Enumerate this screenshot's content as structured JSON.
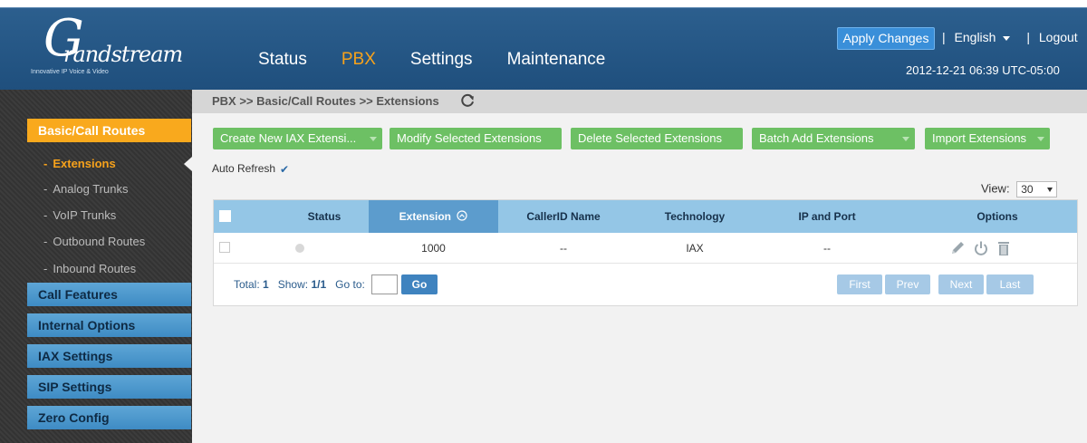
{
  "header": {
    "logo_text": "Grandstream",
    "logo_tagline": "Innovative IP Voice & Video",
    "nav": [
      {
        "label": "Status",
        "active": false
      },
      {
        "label": "PBX",
        "active": true
      },
      {
        "label": "Settings",
        "active": false
      },
      {
        "label": "Maintenance",
        "active": false
      }
    ],
    "apply_changes": "Apply Changes",
    "separator": "|",
    "language": "English",
    "logout": "Logout",
    "datetime": "2012-12-21 06:39 UTC-05:00"
  },
  "sidebar": {
    "active_section": "Basic/Call Routes",
    "sub_items": [
      {
        "label": "Extensions",
        "active": true
      },
      {
        "label": "Analog Trunks",
        "active": false
      },
      {
        "label": "VoIP Trunks",
        "active": false
      },
      {
        "label": "Outbound Routes",
        "active": false
      },
      {
        "label": "Inbound Routes",
        "active": false
      }
    ],
    "sections": [
      "Call Features",
      "Internal Options",
      "IAX Settings",
      "SIP Settings",
      "Zero Config"
    ]
  },
  "breadcrumb": "PBX >> Basic/Call Routes >> Extensions",
  "toolbar": {
    "create": "Create New IAX Extensi...",
    "modify": "Modify Selected Extensions",
    "delete": "Delete Selected Extensions",
    "batch_add": "Batch Add Extensions",
    "import": "Import Extensions"
  },
  "auto_refresh": {
    "label": "Auto Refresh",
    "checked": true
  },
  "view": {
    "label": "View:",
    "value": "30"
  },
  "table": {
    "columns": [
      "Status",
      "Extension",
      "CallerID Name",
      "Technology",
      "IP and Port",
      "Options"
    ],
    "sorted_column": "Extension",
    "rows": [
      {
        "status": "",
        "extension": "1000",
        "callerid": "--",
        "technology": "IAX",
        "ip_port": "--"
      }
    ]
  },
  "pager": {
    "total_label": "Total:",
    "total": "1",
    "show_label": "Show:",
    "show": "1/1",
    "goto_label": "Go to:",
    "go": "Go",
    "first": "First",
    "prev": "Prev",
    "next": "Next",
    "last": "Last"
  },
  "colors": {
    "header_blue": "#1f4f7d",
    "accent_orange": "#f9a91d",
    "button_green": "#6dc064",
    "table_header": "#94c6e6",
    "sidebar_section": "#4b97cd"
  }
}
